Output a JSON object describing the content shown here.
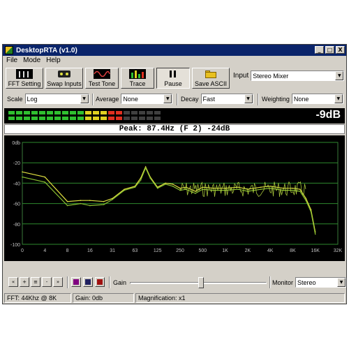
{
  "window": {
    "title": "DesktopRTA (v1.0)"
  },
  "titlebar_buttons": {
    "minimize": "_",
    "maximize": "□",
    "close": "X"
  },
  "menu": [
    "File",
    "Mode",
    "Help"
  ],
  "toolbar": {
    "buttons": [
      "FFT Setting",
      "Swap Inputs",
      "Test Tone",
      "Trace",
      "Pause",
      "Save ASCII"
    ],
    "input_label": "Input",
    "input_value": "Stereo Mixer"
  },
  "controls": {
    "scale_label": "Scale",
    "scale_value": "Log",
    "average_label": "Average",
    "average_value": "None",
    "decay_label": "Decay",
    "decay_value": "Fast",
    "weighting_label": "Weighting",
    "weighting_value": "None"
  },
  "meter": {
    "level_text": "-9dB",
    "colors": {
      "green": "#30c030",
      "yellow": "#e0d020",
      "red": "#e03020",
      "off": "#404040"
    }
  },
  "peak_text": "Peak: 87.4Hz (F 2) -24dB",
  "chart_data": {
    "type": "line",
    "title": "",
    "xlabel": "",
    "ylabel": "",
    "x_scale": "log",
    "x_ticks": [
      "0",
      "4",
      "8",
      "16",
      "31",
      "63",
      "125",
      "250",
      "500",
      "1K",
      "2K",
      "4K",
      "8K",
      "16K",
      "32K"
    ],
    "y_ticks": [
      "0db",
      "-20",
      "-40",
      "-60",
      "-80",
      "-100"
    ],
    "ylim": [
      -100,
      0
    ],
    "grid": true,
    "series": [
      {
        "color": "#e0e040",
        "x": [
          0,
          4,
          8,
          12,
          16,
          24,
          31,
          45,
          63,
          75,
          87,
          100,
          125,
          160,
          200,
          250,
          300,
          400,
          500,
          700,
          1000,
          1500,
          2000,
          3000,
          4000,
          6000,
          8000,
          10000,
          12000,
          14000,
          16000
        ],
        "y": [
          -29,
          -34,
          -58,
          -57,
          -57,
          -58,
          -55,
          -46,
          -43,
          -35,
          -24,
          -34,
          -44,
          -40,
          -41,
          -45,
          -44,
          -48,
          -44,
          -45,
          -45,
          -44,
          -46,
          -44,
          -43,
          -45,
          -45,
          -46,
          -55,
          -66,
          -88
        ]
      },
      {
        "color": "#8ac030",
        "x": [
          0,
          4,
          8,
          12,
          16,
          24,
          31,
          45,
          63,
          75,
          87,
          100,
          125,
          160,
          200,
          250,
          300,
          400,
          500,
          700,
          1000,
          1500,
          2000,
          3000,
          4000,
          6000,
          8000,
          10000,
          12000,
          14000,
          16000
        ],
        "y": [
          -34,
          -39,
          -62,
          -60,
          -62,
          -61,
          -56,
          -47,
          -44,
          -37,
          -25,
          -35,
          -45,
          -41,
          -43,
          -47,
          -46,
          -50,
          -46,
          -47,
          -47,
          -46,
          -48,
          -46,
          -45,
          -47,
          -47,
          -48,
          -57,
          -68,
          -90
        ]
      }
    ]
  },
  "transport": {
    "buttons": [
      "«",
      "+",
      "≡",
      "-",
      "»"
    ],
    "colors": [
      "#800080",
      "#202060",
      "#a01010"
    ],
    "gain_label": "Gain",
    "gain_level": 0.52,
    "monitor_label": "Monitor",
    "monitor_value": "Stereo"
  },
  "status": {
    "fft": "FFT: 44Khz @ 8K",
    "gain": "Gain: 0db",
    "magnification": "Magnification: x1"
  }
}
